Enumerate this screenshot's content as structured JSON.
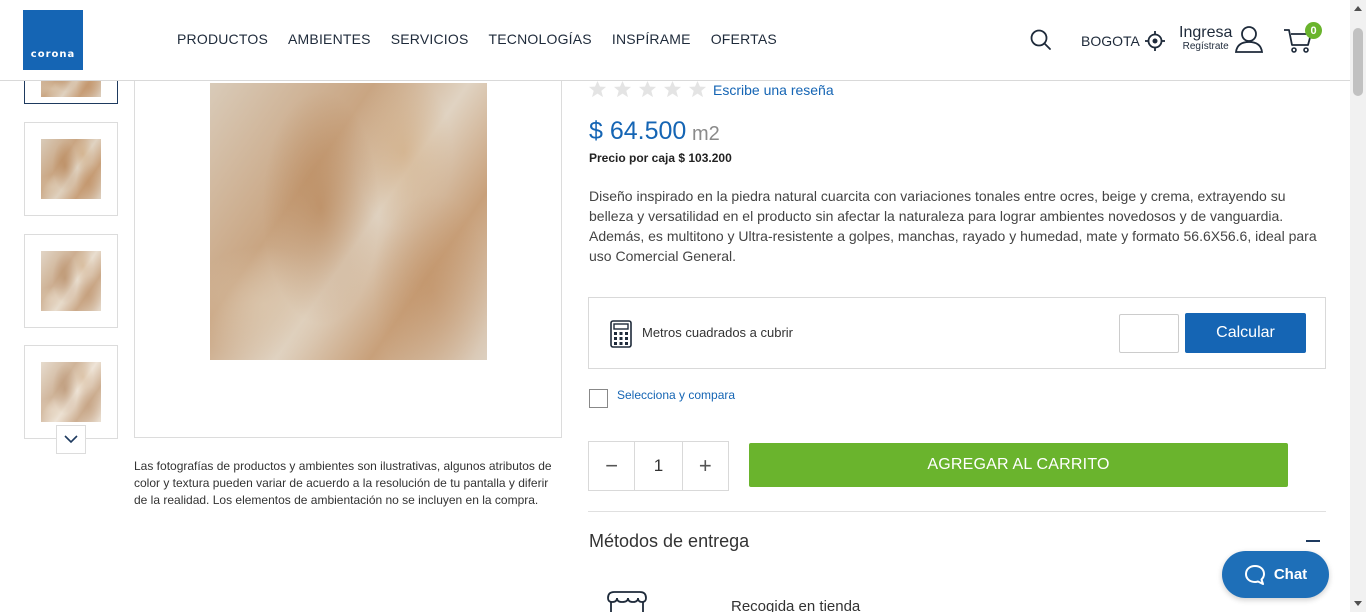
{
  "header": {
    "logo_text": "corona",
    "nav": [
      "PRODUCTOS",
      "AMBIENTES",
      "SERVICIOS",
      "TECNOLOGÍAS",
      "INSPÍRAME",
      "OFERTAS"
    ],
    "city": "BOGOTA",
    "login_label": "Ingresa",
    "register_label": "Regístrate",
    "cart_count": "0"
  },
  "gallery": {
    "thumbnail_count": 4,
    "disclaimer": "Las fotografías de productos y ambientes son ilustrativas, algunos atributos de color y textura pueden variar de acuerdo a la resolución de tu pantalla y diferir de la realidad. Los elementos de ambientación no se incluyen en la compra."
  },
  "product": {
    "rating_stars": 0,
    "review_link": "Escribe una reseña",
    "price": "$ 64.500",
    "price_unit": "m2",
    "box_price": "Precio por caja $ 103.200",
    "description": "Diseño inspirado en la piedra natural cuarcita con variaciones tonales entre ocres, beige y crema, extrayendo su belleza y versatilidad en el producto sin afectar la naturaleza para lograr ambientes novedosos y de vanguardia. Además, es multitono y Ultra-resistente a golpes, manchas, rayado y humedad, mate y formato 56.6X56.6, ideal para uso Comercial General."
  },
  "calculator": {
    "label": "Metros cuadrados a cubrir",
    "input_value": "",
    "button": "Calcular"
  },
  "compare": {
    "label": "Selecciona y compara"
  },
  "purchase": {
    "quantity": "1",
    "minus": "−",
    "plus": "+",
    "add_to_cart": "AGREGAR AL CARRITO"
  },
  "delivery": {
    "title": "Métodos de entrega",
    "pickup": "Recogida en tienda"
  },
  "chat": {
    "label": "Chat"
  },
  "colors": {
    "brand_blue": "#1565b4",
    "cta_green": "#6ab42d"
  }
}
